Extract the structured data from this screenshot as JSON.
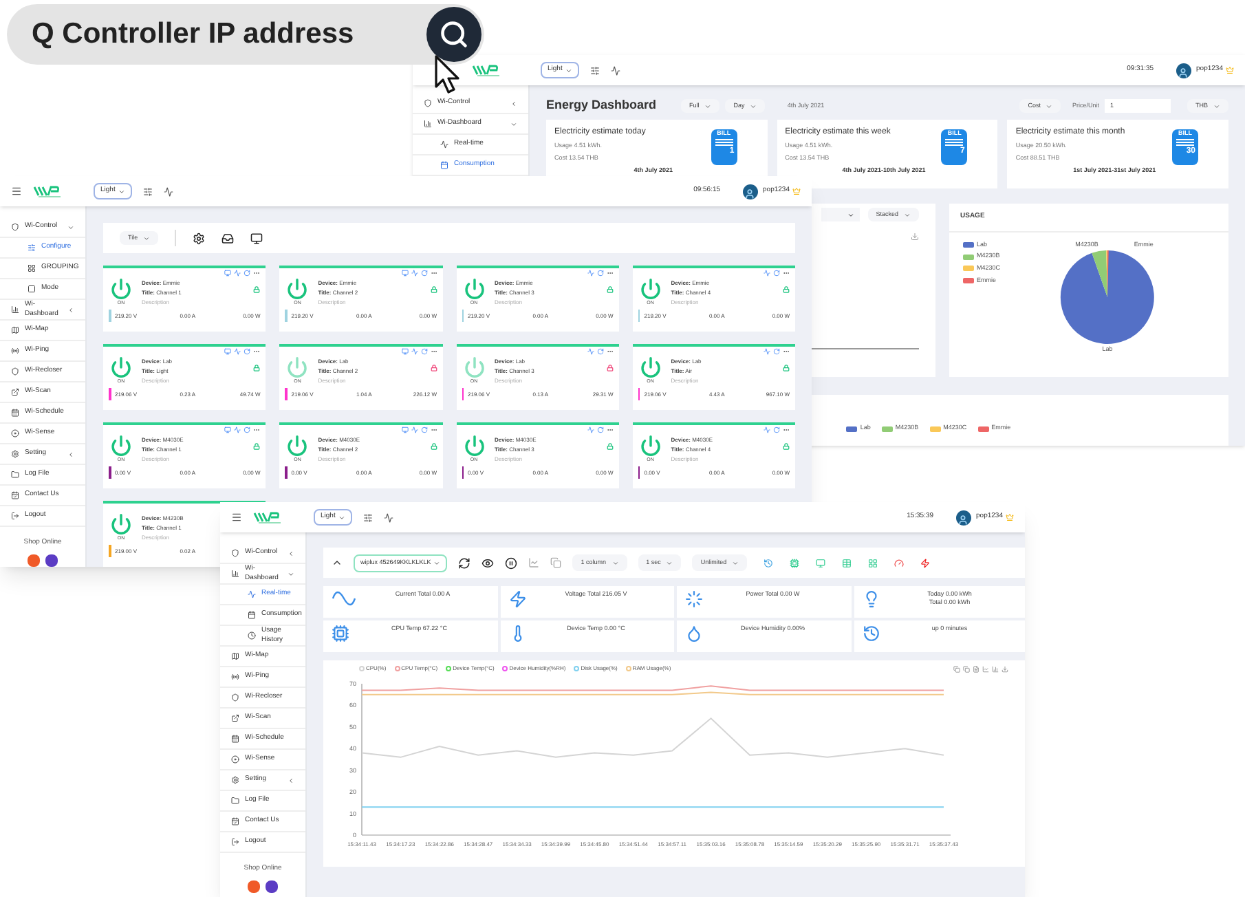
{
  "search_banner": {
    "text": "Q Controller IP address"
  },
  "energy_window": {
    "header": {
      "theme": "Light",
      "time": "09:31:35",
      "user": "pop1234"
    },
    "sidebar": [
      {
        "label": "Wi-Control",
        "expanded": false
      },
      {
        "label": "Wi-Dashboard",
        "expanded": true,
        "children": [
          {
            "label": "Real-time",
            "selected": false
          },
          {
            "label": "Consumption",
            "selected": true
          }
        ]
      }
    ],
    "title": "Energy Dashboard",
    "filters": [
      "Full",
      "Day"
    ],
    "date": "4th July 2021",
    "cost_select": "Cost",
    "price_label": "Price/Unit",
    "price_value": "1",
    "currency": "THB",
    "estimates": [
      {
        "title": "Electricity estimate today",
        "usage": "Usage 4.51 kWh.",
        "cost": "Cost 13.54 THB",
        "period": "4th July 2021",
        "bill_label": "BILL",
        "bill_number": "1"
      },
      {
        "title": "Electricity estimate this week",
        "usage": "Usage 4.51 kWh.",
        "cost": "Cost 13.54 THB",
        "period": "4th July 2021-10th July 2021",
        "bill_label": "BILL",
        "bill_number": "7"
      },
      {
        "title": "Electricity estimate this month",
        "usage": "Usage 20.50 kWh.",
        "cost": "Cost 88.51 THB",
        "period": "1st July 2021-31st July 2021",
        "bill_label": "BILL",
        "bill_number": "30"
      }
    ],
    "trend_panel": {
      "stack_mode": "Stacked"
    },
    "usage_panel": {
      "title": "USAGE",
      "legend": [
        {
          "label": "Lab",
          "color": "#5470c6"
        },
        {
          "label": "M4230B",
          "color": "#91cc75"
        },
        {
          "label": "M4230C",
          "color": "#fac858"
        },
        {
          "label": "Emmie",
          "color": "#ee6666"
        }
      ],
      "slice_labels": [
        "M4230B",
        "Emmie",
        "Lab"
      ]
    },
    "bottom_legend": [
      {
        "label": "Lab",
        "color": "#5470c6"
      },
      {
        "label": "M4230B",
        "color": "#91cc75"
      },
      {
        "label": "M4230C",
        "color": "#fac858"
      },
      {
        "label": "Emmie",
        "color": "#ee6666"
      }
    ]
  },
  "tiles_window": {
    "header": {
      "theme": "Light",
      "time": "09:56:15",
      "user": "pop1234"
    },
    "sidebar": [
      {
        "label": "Wi-Control",
        "expanded": true,
        "children": [
          {
            "label": "Configure",
            "selected": true
          },
          {
            "label": "GROUPING",
            "selected": false
          },
          {
            "label": "Mode",
            "selected": false
          }
        ]
      },
      {
        "label": "Wi-Dashboard",
        "expanded": false
      },
      {
        "label": "Wi-Map"
      },
      {
        "label": "Wi-Ping"
      },
      {
        "label": "Wi-Recloser"
      },
      {
        "label": "Wi-Scan"
      },
      {
        "label": "Wi-Schedule"
      },
      {
        "label": "Wi-Sense"
      },
      {
        "label": "Setting",
        "expanded": false
      },
      {
        "label": "Log File"
      },
      {
        "label": "Contact Us"
      },
      {
        "label": "Logout"
      }
    ],
    "shop_label": "Shop Online",
    "view_select": "Tile",
    "tiles": [
      {
        "device": "**Device:** Emmie",
        "title": "**Title:** Channel 1",
        "description": "Description",
        "state": "ON",
        "active": true,
        "monitor": true,
        "locked": false,
        "color": "#9fd3e0",
        "voltage": "219.20 V",
        "current": "0.00 A",
        "power": "0.00 W"
      },
      {
        "device": "**Device:** Emmie",
        "title": "**Title:** Channel 2",
        "description": "Description",
        "state": "ON",
        "active": true,
        "monitor": true,
        "locked": false,
        "color": "#9fd3e0",
        "voltage": "219.20 V",
        "current": "0.00 A",
        "power": "0.00 W"
      },
      {
        "device": "**Device:** Emmie",
        "title": "**Title:** Channel 3",
        "description": "Description",
        "state": "ON",
        "active": true,
        "monitor": false,
        "locked": false,
        "color": "#9fd3e0",
        "voltage": "219.20 V",
        "current": "0.00 A",
        "power": "0.00 W"
      },
      {
        "device": "**Device:** Emmie",
        "title": "**Title:** Channel 4",
        "description": "Description",
        "state": "ON",
        "active": true,
        "monitor": false,
        "locked": false,
        "color": "#9fd3e0",
        "voltage": "219.20 V",
        "current": "0.00 A",
        "power": "0.00 W"
      },
      {
        "device": "**Device:** Lab",
        "title": "**Title:** Light",
        "description": "Description",
        "state": "ON",
        "active": true,
        "monitor": true,
        "locked": false,
        "color": "#ff33cc",
        "voltage": "219.06 V",
        "current": "0.23 A",
        "power": "49.74 W"
      },
      {
        "device": "**Device:** Lab",
        "title": "**Title:** Channel 2",
        "description": "Description",
        "state": "ON",
        "active": false,
        "monitor": true,
        "locked": true,
        "color": "#ff33cc",
        "voltage": "219.06 V",
        "current": "1.04 A",
        "power": "226.12 W"
      },
      {
        "device": "**Device:** Lab",
        "title": "**Title:** Channel 3",
        "description": "Description",
        "state": "ON",
        "active": false,
        "monitor": false,
        "locked": true,
        "color": "#ff33cc",
        "voltage": "219.06 V",
        "current": "0.13 A",
        "power": "29.31 W"
      },
      {
        "device": "**Device:** Lab",
        "title": "**Title:** Air",
        "description": "Description",
        "state": "ON",
        "active": true,
        "monitor": false,
        "locked": false,
        "color": "#ff33cc",
        "voltage": "219.06 V",
        "current": "4.43 A",
        "power": "967.10 W"
      },
      {
        "device": "**Device:** M4030E",
        "title": "**Title:** Channel 1",
        "description": "Description",
        "state": "ON",
        "active": true,
        "monitor": true,
        "locked": false,
        "color": "#8b1e8b",
        "voltage": "0.00 V",
        "current": "0.00 A",
        "power": "0.00 W"
      },
      {
        "device": "**Device:** M4030E",
        "title": "**Title:** Channel 2",
        "description": "Description",
        "state": "ON",
        "active": true,
        "monitor": true,
        "locked": false,
        "color": "#8b1e8b",
        "voltage": "0.00 V",
        "current": "0.00 A",
        "power": "0.00 W"
      },
      {
        "device": "**Device:** M4030E",
        "title": "**Title:** Channel 3",
        "description": "Description",
        "state": "ON",
        "active": true,
        "monitor": false,
        "locked": false,
        "color": "#8b1e8b",
        "voltage": "0.00 V",
        "current": "0.00 A",
        "power": "0.00 W"
      },
      {
        "device": "**Device:** M4030E",
        "title": "**Title:** Channel 4",
        "description": "Description",
        "state": "ON",
        "active": true,
        "monitor": false,
        "locked": false,
        "color": "#8b1e8b",
        "voltage": "0.00 V",
        "current": "0.00 A",
        "power": "0.00 W"
      },
      {
        "device": "**Device:** M4230B",
        "title": "**Title:** Channel 1",
        "description": "Description",
        "state": "ON",
        "active": true,
        "color": "#f5a623",
        "voltage": "219.00 V",
        "current": "0.02 A"
      }
    ]
  },
  "realtime_window": {
    "header": {
      "theme": "Light",
      "time": "15:35:39",
      "user": "pop1234"
    },
    "sidebar": [
      {
        "label": "Wi-Control",
        "expanded": false
      },
      {
        "label": "Wi-Dashboard",
        "expanded": true,
        "children": [
          {
            "label": "Real-time",
            "selected": true
          },
          {
            "label": "Consumption",
            "selected": false
          },
          {
            "label": "Usage History",
            "selected": false
          }
        ]
      },
      {
        "label": "Wi-Map"
      },
      {
        "label": "Wi-Ping"
      },
      {
        "label": "Wi-Recloser"
      },
      {
        "label": "Wi-Scan"
      },
      {
        "label": "Wi-Schedule"
      },
      {
        "label": "Wi-Sense"
      },
      {
        "label": "Setting",
        "expanded": false
      },
      {
        "label": "Log File"
      },
      {
        "label": "Contact Us"
      },
      {
        "label": "Logout"
      }
    ],
    "shop_label": "Shop Online",
    "device_select": "wiplux 452649KKLKLKLK",
    "selects": [
      "1 column",
      "1 sec",
      "Unlimited"
    ],
    "stats": [
      {
        "lines": [
          "Current Total 0.00 A"
        ]
      },
      {
        "lines": [
          "Voltage Total 216.05 V"
        ]
      },
      {
        "lines": [
          "Power Total 0.00 W"
        ]
      },
      {
        "lines": [
          "Today 0.00 kWh",
          "Total 0.00 kWh"
        ]
      },
      {
        "lines": [
          "CPU Temp 67.22 °C"
        ]
      },
      {
        "lines": [
          "Device Temp 0.00 °C"
        ]
      },
      {
        "lines": [
          "Device Humidity 0.00%"
        ]
      },
      {
        "lines": [
          "up 0 minutes"
        ]
      }
    ],
    "chart_data": {
      "type": "line",
      "categories": [
        "15:34:11.43",
        "15:34:17.23",
        "15:34:22.86",
        "15:34:28.47",
        "15:34:34.33",
        "15:34:39.99",
        "15:34:45.80",
        "15:34:51.44",
        "15:34:57.11",
        "15:35:03.16",
        "15:35:08.78",
        "15:35:14.59",
        "15:35:20.29",
        "15:35:25.90",
        "15:35:31.71",
        "15:35:37.43"
      ],
      "ylim": [
        0,
        70
      ],
      "yticks": [
        0,
        10,
        20,
        30,
        40,
        50,
        60,
        70
      ],
      "series": [
        {
          "name": "CPU(%)",
          "color": "#d4d4d4",
          "values": [
            38,
            36,
            41,
            37,
            39,
            36,
            38,
            37,
            39,
            54,
            37,
            38,
            36,
            38,
            40,
            37
          ]
        },
        {
          "name": "CPU Temp(°C)",
          "color": "#f0a0a0",
          "values": [
            67,
            67,
            68,
            67,
            67,
            67,
            67,
            67,
            67,
            69,
            67,
            67,
            67,
            67,
            67,
            67
          ]
        },
        {
          "name": "Device Temp(°C)",
          "color": "#55dd55",
          "values": [
            null,
            null,
            null,
            null,
            null,
            null,
            null,
            null,
            null,
            null,
            null,
            null,
            null,
            null,
            null,
            null
          ]
        },
        {
          "name": "Device Humidity(%RH)",
          "color": "#ee55ee",
          "values": [
            null,
            null,
            null,
            null,
            null,
            null,
            null,
            null,
            null,
            null,
            null,
            null,
            null,
            null,
            null,
            null
          ]
        },
        {
          "name": "Disk Usage(%)",
          "color": "#7fd0ef",
          "values": [
            13,
            13,
            13,
            13,
            13,
            13,
            13,
            13,
            13,
            13,
            13,
            13,
            13,
            13,
            13,
            13
          ]
        },
        {
          "name": "RAM Usage(%)",
          "color": "#f2c98a",
          "values": [
            65,
            65,
            65,
            65,
            65,
            65,
            65,
            65,
            65,
            66,
            65,
            65,
            65,
            65,
            65,
            65
          ]
        }
      ]
    }
  }
}
